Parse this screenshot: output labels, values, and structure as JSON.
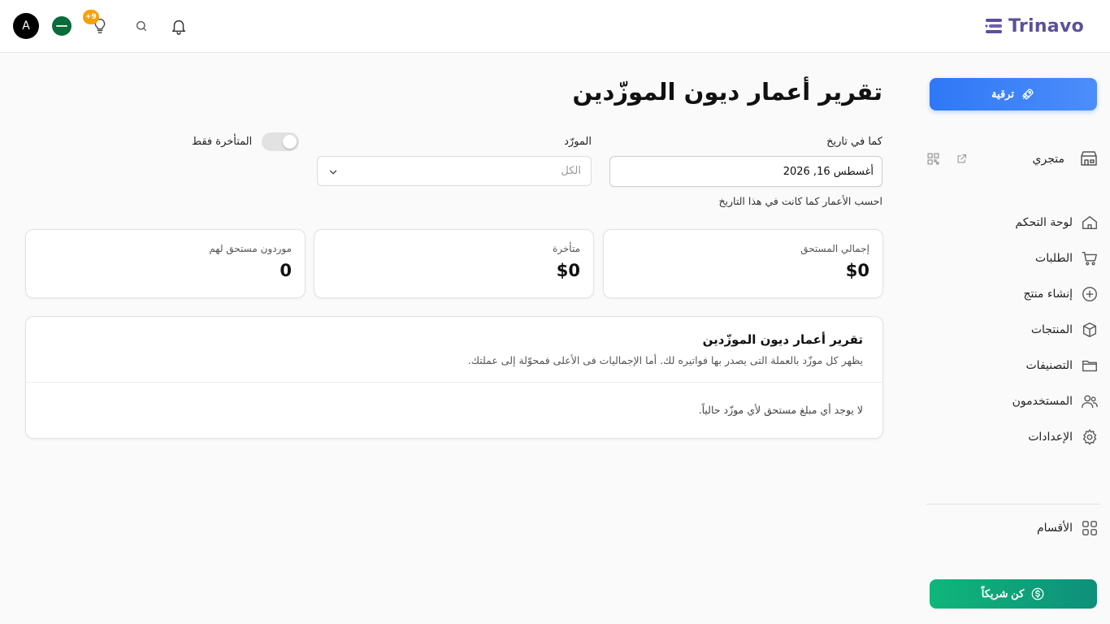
{
  "header": {
    "brand": "Trinavo",
    "avatar_initial": "A",
    "tips_badge": "+9"
  },
  "sidebar": {
    "upgrade_label": "ترقية",
    "store_label": "متجري",
    "items": [
      {
        "label": "لوحة التحكم",
        "icon": "home-icon"
      },
      {
        "label": "الطلبات",
        "icon": "cart-icon"
      },
      {
        "label": "إنشاء منتج",
        "icon": "plus-circle-icon"
      },
      {
        "label": "المنتجات",
        "icon": "box-icon"
      },
      {
        "label": "التصنيفات",
        "icon": "folder-icon"
      },
      {
        "label": "المستخدمون",
        "icon": "users-icon"
      },
      {
        "label": "الإعدادات",
        "icon": "gear-icon"
      }
    ],
    "sections_label": "الأقسام",
    "partner_label": "كن شريكاً"
  },
  "main": {
    "title": "تقرير أعمار ديون الموزّدين",
    "as_of_label": "كما في تاريخ",
    "as_of_value": "أغسطس 16, 2026",
    "as_of_hint": "احسب الأعمار كما كانت في هذا التاريخ",
    "supplier_label": "المورّد",
    "supplier_placeholder": "الكل",
    "overdue_only_label": "المتأخرة فقط",
    "stats": [
      {
        "label": "إجمالي المستحق",
        "value": "$0"
      },
      {
        "label": "متأخرة",
        "value": "$0"
      },
      {
        "label": "موردون مستحق لهم",
        "value": "0"
      }
    ],
    "report": {
      "title": "تقرير أعمار ديون الموزّدين",
      "description": "يظهر كل موزّد بالعملة التى يصدر بها فواتيره لك. أما الإجماليات فى الأعلى فمحوّلة إلى عملتك.",
      "empty": "لا يوجد أي مبلغ مستحق لأي موزّد حالياً."
    }
  },
  "colors": {
    "brand": "#5b4f9a",
    "upgrade": "#2f78f6",
    "partner": "#0fb67a",
    "badge": "#f5a10a"
  }
}
